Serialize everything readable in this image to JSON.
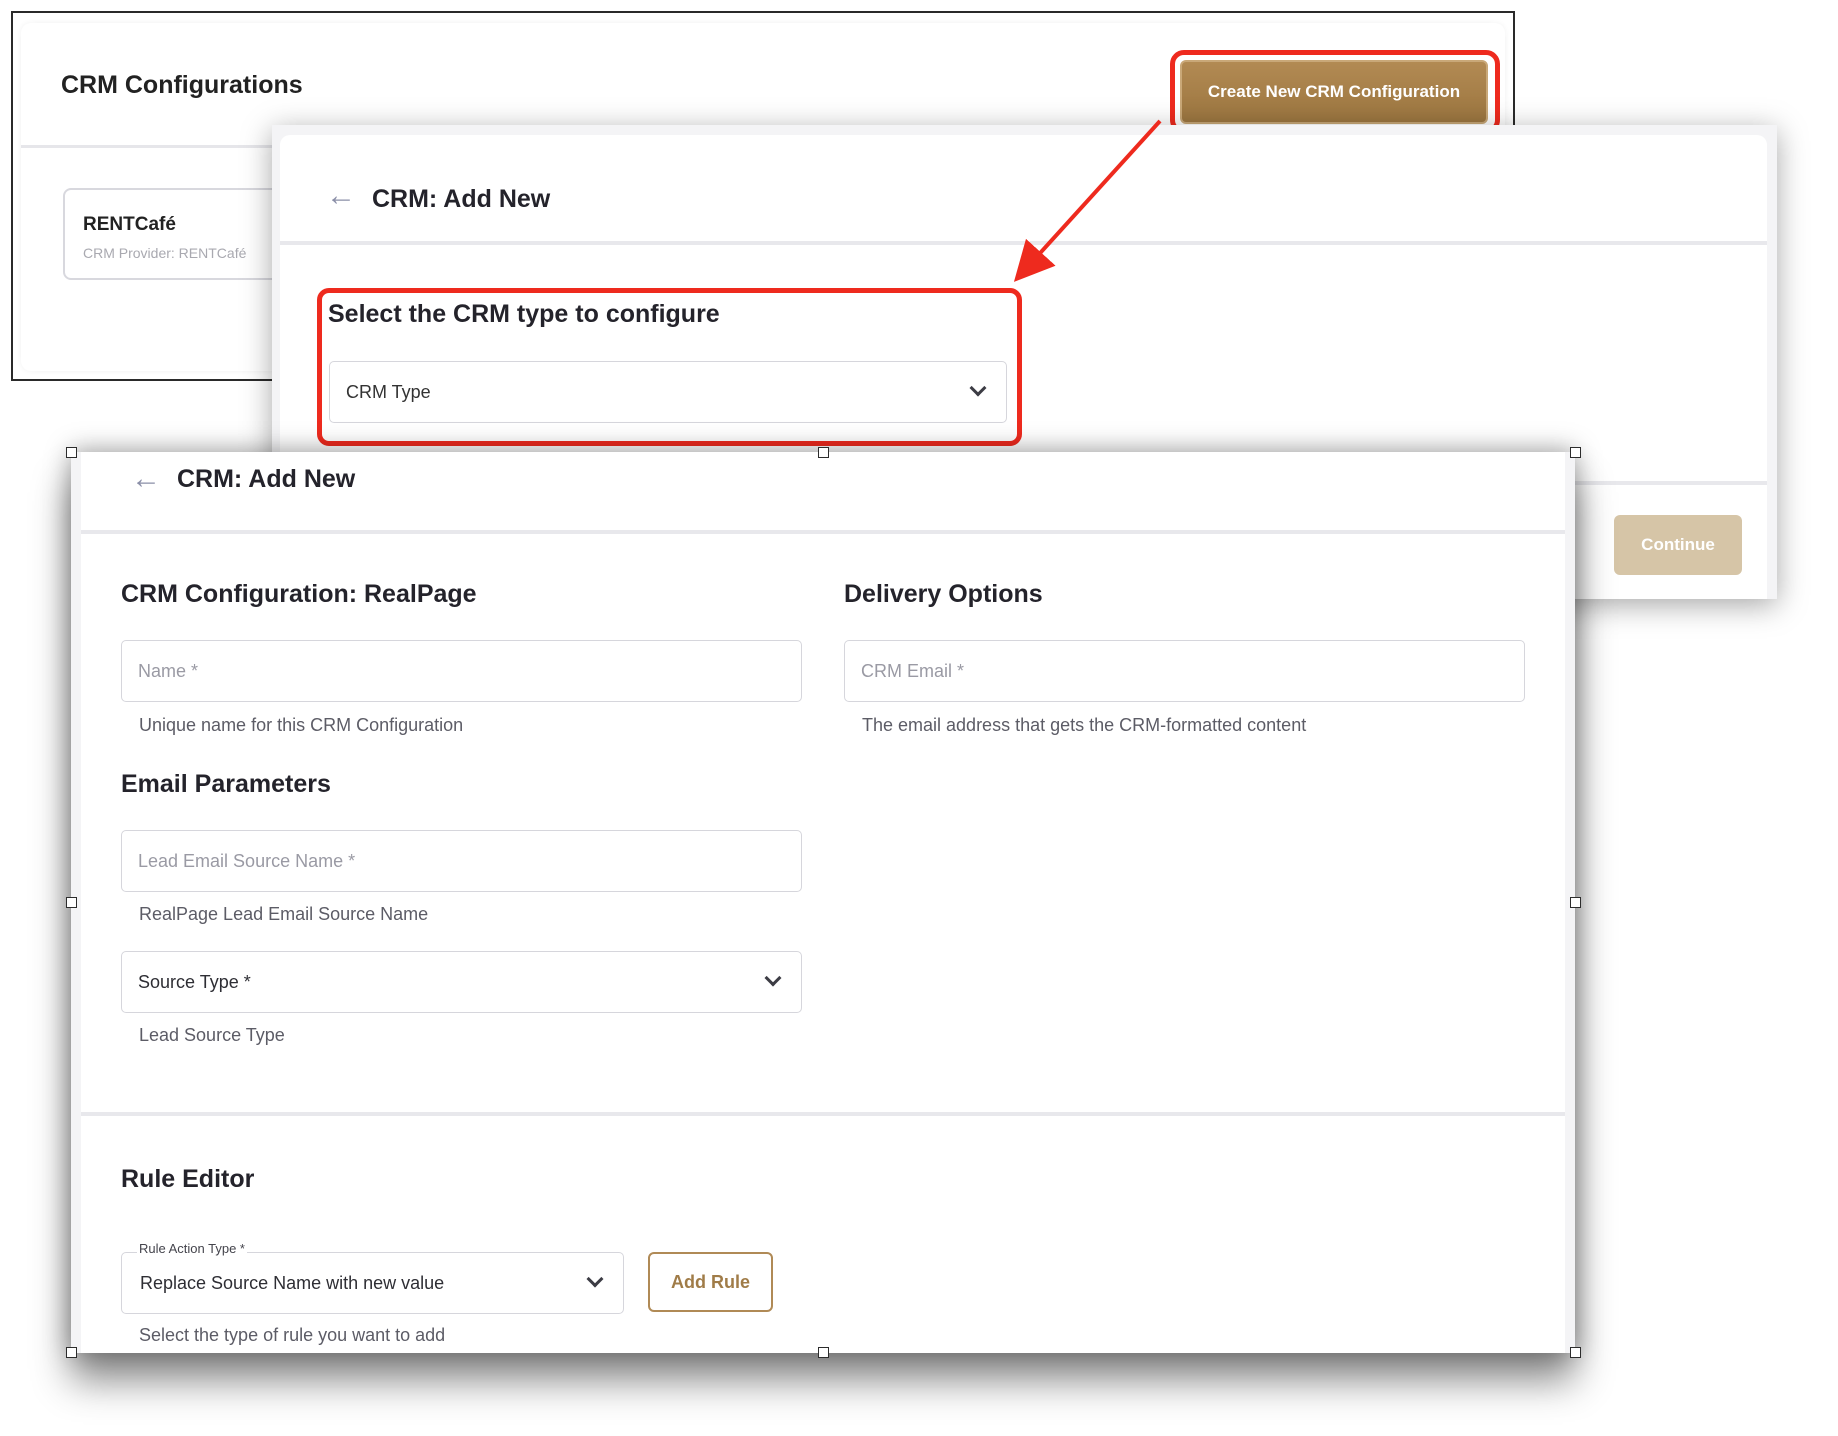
{
  "list_view": {
    "title": "CRM Configurations",
    "create_button": "Create New CRM Configuration",
    "configs": [
      {
        "name": "RENTCafé",
        "provider": "CRM Provider: RENTCafé"
      }
    ]
  },
  "type_select_view": {
    "title": "CRM: Add New",
    "heading": "Select the CRM type to configure",
    "crm_type_placeholder": "CRM Type",
    "continue_button": "Continue"
  },
  "form_view": {
    "title": "CRM: Add New",
    "config_section_title": "CRM Configuration: RealPage",
    "name_placeholder": "Name *",
    "name_helper": "Unique name for this CRM Configuration",
    "delivery_section_title": "Delivery Options",
    "crm_email_placeholder": "CRM Email *",
    "crm_email_helper": "The email address that gets the CRM-formatted content",
    "email_params_title": "Email Parameters",
    "lead_source_placeholder": "Lead Email Source Name *",
    "lead_source_helper": "RealPage Lead Email Source Name",
    "source_type_label": "Source Type *",
    "source_type_helper": "Lead Source Type",
    "rule_editor_title": "Rule Editor",
    "rule_action_label": "Rule Action Type *",
    "rule_action_value": "Replace Source Name with new value",
    "rule_action_helper": "Select the type of rule you want to add",
    "add_rule_button": "Add Rule"
  },
  "colors": {
    "brand_gold": "#a5804a",
    "highlight_red": "#ee2a1e",
    "continue_disabled": "#d6c5a7"
  },
  "icons": [
    "back-arrow-icon",
    "chevron-down-icon"
  ]
}
